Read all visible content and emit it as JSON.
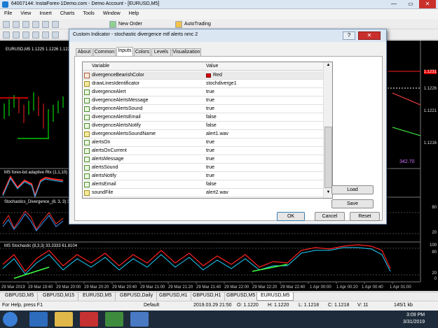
{
  "window": {
    "title": "64007144: InstaForex-1Demo.com - Demo Account - [EURUSD,M5]"
  },
  "menu": [
    "File",
    "View",
    "Insert",
    "Charts",
    "Tools",
    "Window",
    "Help"
  ],
  "toolbar": {
    "new_order": "New Order",
    "autotrading": "AutoTrading"
  },
  "chart": {
    "main_header": "EURUSD,M5  1.1225 1.1226 1.1225 1.1225",
    "price_labels": [
      "1.1231",
      "1.1226",
      "1.1221",
      "1.1216"
    ],
    "right_value": "342.70",
    "rsx_header": "MS forex-bd adaptive Rtx (1,1,10)",
    "stoch_div_header": "Stochastics_Divergence_(8, 3, 3) 33",
    "ms_stoch_header": "MS Stochastic (8,3,3) 33.3333 61.8104",
    "level_labels": [
      "80",
      "20",
      "100",
      "80",
      "20",
      "0"
    ],
    "time_labels": [
      "29 Mar 2019",
      "29 Mar 19:40",
      "29 Mar 20:00",
      "29 Mar 20:20",
      "29 Mar 20:40",
      "29 Mar 21:00",
      "29 Mar 21:20",
      "29 Mar 21:40",
      "29 Mar 22:00",
      "29 Mar 22:20",
      "29 Mar 22:40",
      "1 Apr 00:00",
      "1 Apr 00:20",
      "1 Apr 00:40",
      "1 Apr 01:00"
    ]
  },
  "chart_tabs": [
    "GBPUSD,M5",
    "GBPUSD,M15",
    "EURUSD,M5",
    "GBPUSD,Daily",
    "GBPUSD,H1",
    "GBPUSD,H1",
    "GBPUSD,M5",
    "EURUSD,M5"
  ],
  "status": {
    "help": "For Help, press F1",
    "profile": "Default",
    "datetime": "2019.03.29 21:50",
    "open": "O: 1.1220",
    "high": "H: 1.1220",
    "low": "L: 1.1218",
    "close": "C: 1.1218",
    "volume": "V: 11",
    "traffic": "145/1 kb"
  },
  "dialog": {
    "title": "Custom Indicator - stochastic divergence mtf alerts nmc 2",
    "tabs": [
      "About",
      "Common",
      "Inputs",
      "Colors",
      "Levels",
      "Visualization"
    ],
    "grid_headers": {
      "variable": "Variable",
      "value": "Value"
    },
    "rows": [
      {
        "name": "divergenceBearishColor",
        "value": "Red",
        "type": "col"
      },
      {
        "name": "drawLinesIdentificator",
        "value": "stochdiverge1",
        "type": "str"
      },
      {
        "name": "divergenceAlert",
        "value": "true",
        "type": "bool"
      },
      {
        "name": "divergenceAlertsMessage",
        "value": "true",
        "type": "bool"
      },
      {
        "name": "divergenceAlertsSound",
        "value": "true",
        "type": "bool"
      },
      {
        "name": "divergenceAlertsEmail",
        "value": "false",
        "type": "bool"
      },
      {
        "name": "divergenceAlertsNotify",
        "value": "false",
        "type": "bool"
      },
      {
        "name": "divergenceAlertsSoundName",
        "value": "alert1.wav",
        "type": "str"
      },
      {
        "name": "alertsOn",
        "value": "true",
        "type": "bool"
      },
      {
        "name": "alertsOnCurrent",
        "value": "true",
        "type": "bool"
      },
      {
        "name": "alertsMessage",
        "value": "true",
        "type": "bool"
      },
      {
        "name": "alertsSound",
        "value": "true",
        "type": "bool"
      },
      {
        "name": "alertsNotify",
        "value": "true",
        "type": "bool"
      },
      {
        "name": "alertsEmail",
        "value": "false",
        "type": "bool"
      },
      {
        "name": "soundFile",
        "value": "alert2.wav",
        "type": "str"
      }
    ],
    "buttons": {
      "load": "Load",
      "save": "Save",
      "ok": "OK",
      "cancel": "Cancel",
      "reset": "Reset"
    }
  },
  "taskbar": {
    "time": "3:09 PM",
    "date": "3/31/2019"
  },
  "colors": {
    "bearish_swatch": "#e00000"
  }
}
